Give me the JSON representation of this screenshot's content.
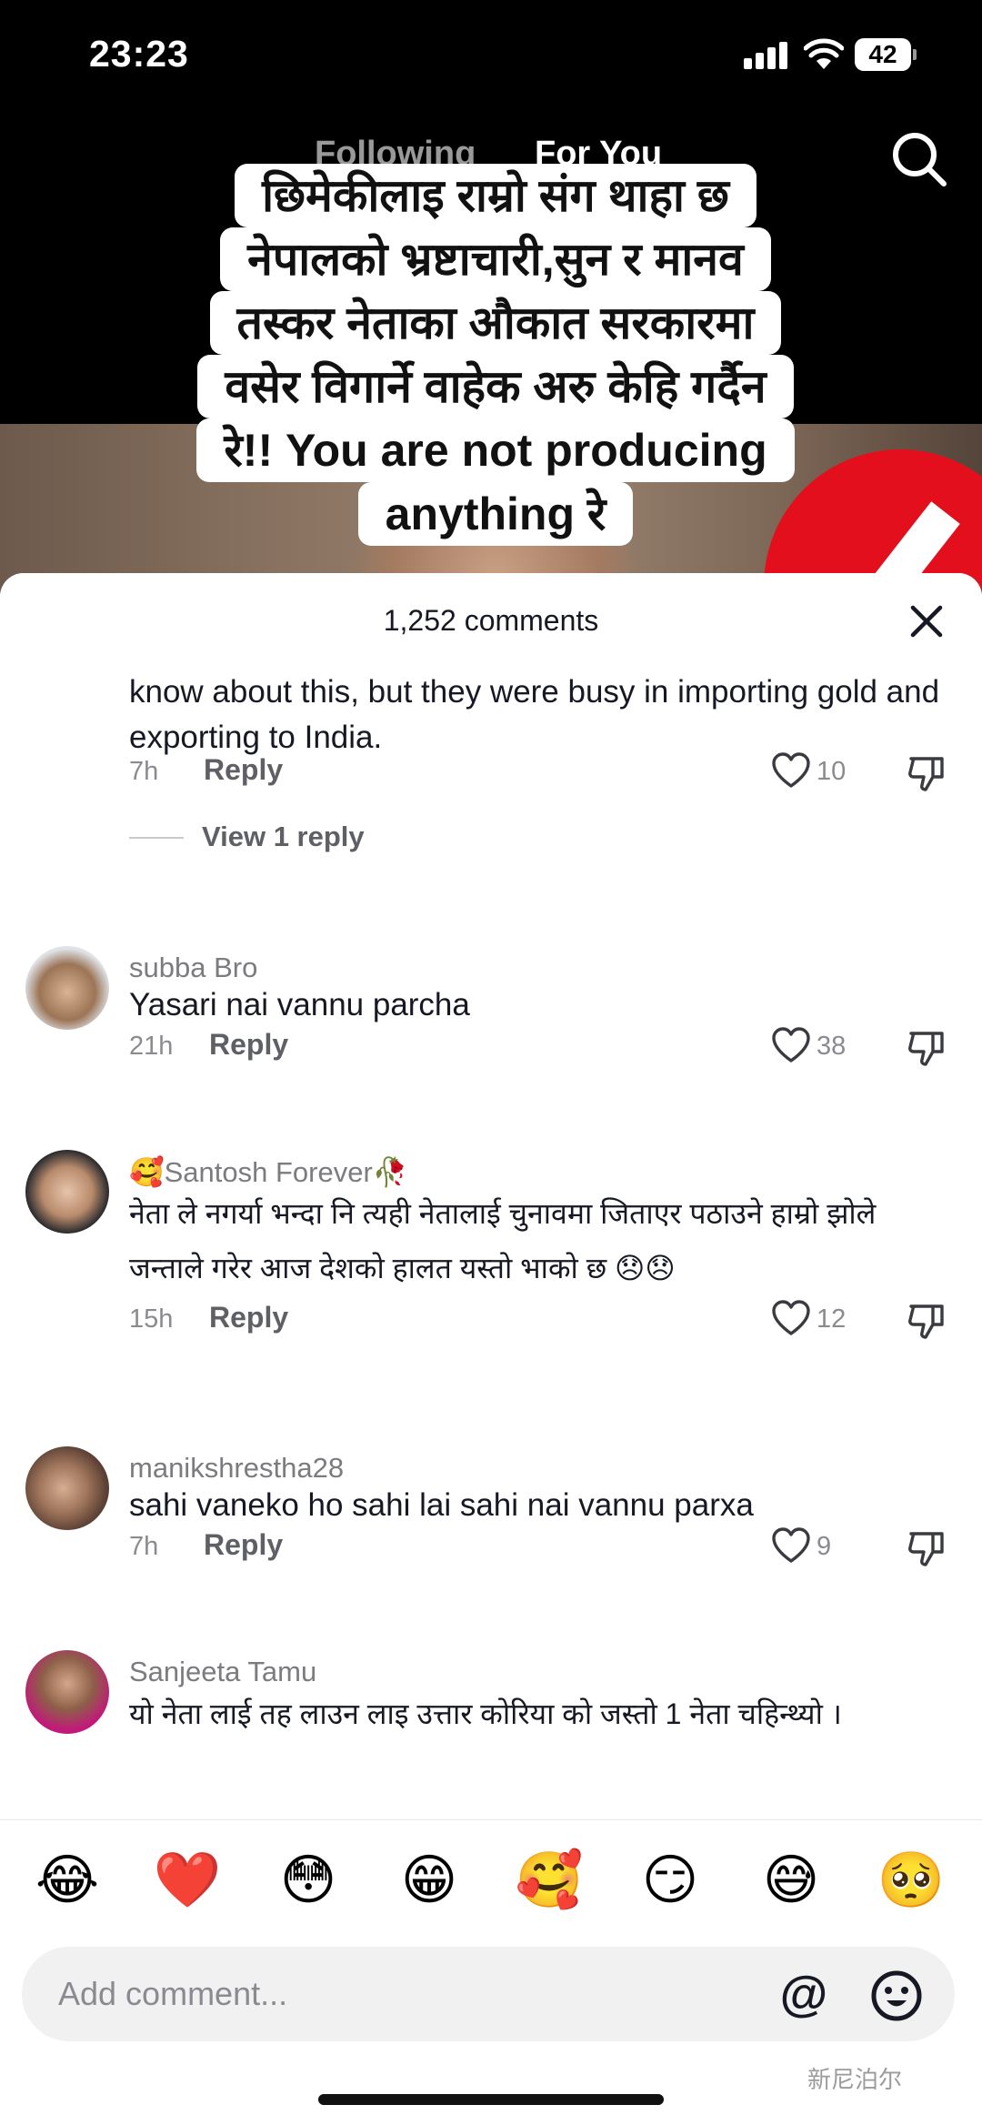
{
  "status_bar": {
    "time": "23:23",
    "battery": "42"
  },
  "top_tabs": {
    "following": "Following",
    "for_you": "For You"
  },
  "caption": {
    "lines": [
      "छिमेकीलाइ राम्रो संग थाहा छ",
      "नेपालको भ्रष्टाचारी,सुन र मानव",
      "तस्कर नेताका औकात सरकारमा",
      "वसेर विगार्ने वाहेक अरु केहि गर्दैन",
      "रे!! You are not producing",
      "anything रे"
    ]
  },
  "comments_sheet": {
    "count_label": "1,252 comments",
    "reply_label": "Reply",
    "comments": [
      {
        "username": "",
        "text": "Absolutely true... we, our govt and our great politician know about this, but they were busy in importing gold and exporting to India.",
        "time": "7h",
        "likes": "10",
        "view_replies": "View 1 reply"
      },
      {
        "username": "subba Bro",
        "text": "Yasari nai vannu parcha",
        "time": "21h",
        "likes": "38"
      },
      {
        "username": "🥰Santosh Forever🥀",
        "text": "नेता ले नगर्या भन्दा नि त्यही नेतालाई चुनावमा जिताएर पठाउने हाम्रो झोले जन्ताले गरेर आज देशको हालत यस्तो भाको छ 😞😞",
        "time": "15h",
        "likes": "12"
      },
      {
        "username": "manikshrestha28",
        "text": "sahi vaneko ho sahi lai sahi nai vannu parxa",
        "time": "7h",
        "likes": "9"
      },
      {
        "username": "Sanjeeta Tamu",
        "text": "यो नेता लाई तह लाउन लाइ उत्तार कोरिया को जस्तो 1 नेता चहिन्थ्यो ।"
      }
    ]
  },
  "emoji_bar": [
    "😂",
    "❤️",
    "😳",
    "😁",
    "🥰",
    "😏",
    "😅",
    "🥺"
  ],
  "input": {
    "placeholder": "Add comment...",
    "mention": "@"
  },
  "watermark": "新尼泊尔",
  "colors": {
    "like_outline": "#161823",
    "sheet_bg": "#ffffff",
    "input_bg": "#f1f1f2"
  }
}
